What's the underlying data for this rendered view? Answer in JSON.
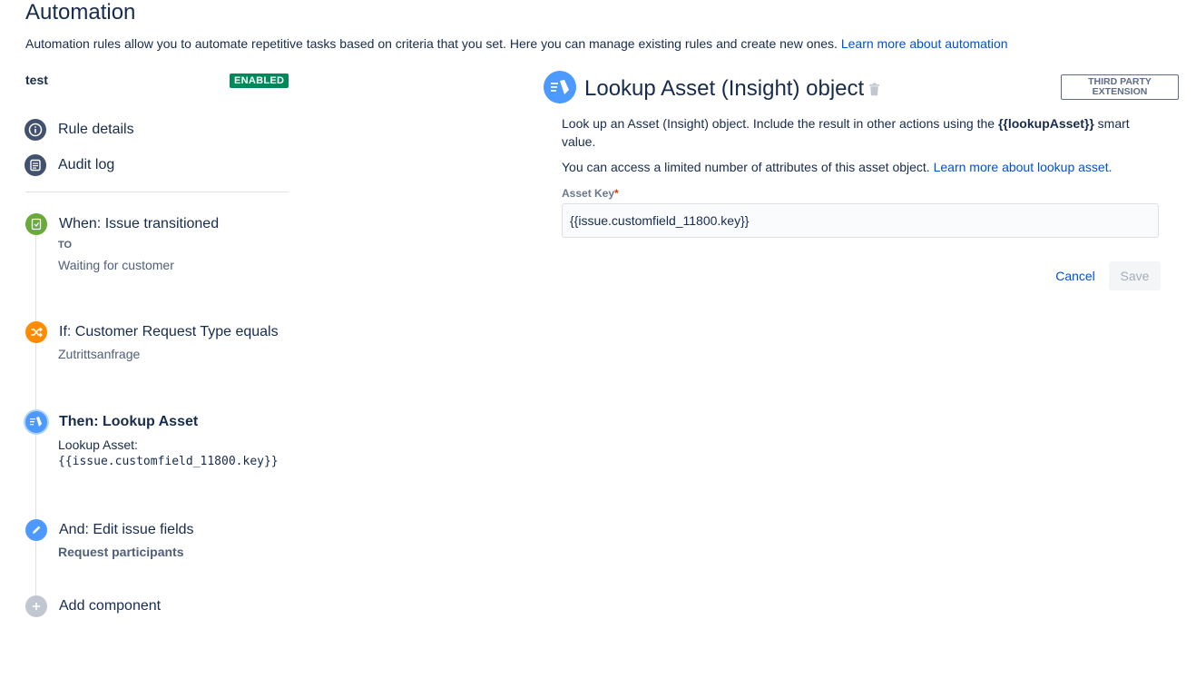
{
  "header": {
    "title": "Automation",
    "description": "Automation rules allow you to automate repetitive tasks based on criteria that you set. Here you can manage existing rules and create new ones. ",
    "learn_more": "Learn more about automation"
  },
  "rule": {
    "name": "test",
    "status": "ENABLED"
  },
  "nav": {
    "rule_details": "Rule details",
    "audit_log": "Audit log"
  },
  "components": [
    {
      "title": "When: Issue transitioned",
      "sub1": "TO",
      "sub2": "Waiting for customer",
      "icon": "transition-icon",
      "color": "#6aaa3a"
    },
    {
      "title": "If: Customer Request Type equals",
      "sub1": "Zutrittsanfrage",
      "icon": "shuffle-icon",
      "color": "#ff8b00"
    },
    {
      "title": "Then: Lookup Asset",
      "sub1": "Lookup Asset:",
      "sub2": "{{issue.customfield_11800.key}}",
      "icon": "asset-icon",
      "color": "#4c9aff"
    },
    {
      "title": "And: Edit issue fields",
      "sub1": "Request participants",
      "icon": "pencil-icon",
      "color": "#4c9aff"
    },
    {
      "title": "Add component",
      "icon": "plus-icon",
      "color": "#c1c7d0"
    }
  ],
  "panel": {
    "title": "Lookup Asset (Insight) object",
    "badge_line1": "THIRD PARTY",
    "badge_line2": "EXTENSION",
    "desc1_pre": "Look up an Asset (Insight) object. Include the result in other actions using the ",
    "desc1_bold": "{{lookupAsset}}",
    "desc1_post": " smart value.",
    "desc2": "You can access a limited number of attributes of this asset object. ",
    "desc2_link": "Learn more about lookup asset.",
    "field_label": "Asset Key",
    "field_required": "*",
    "field_value": "{{issue.customfield_11800.key}}",
    "cancel": "Cancel",
    "save": "Save"
  }
}
